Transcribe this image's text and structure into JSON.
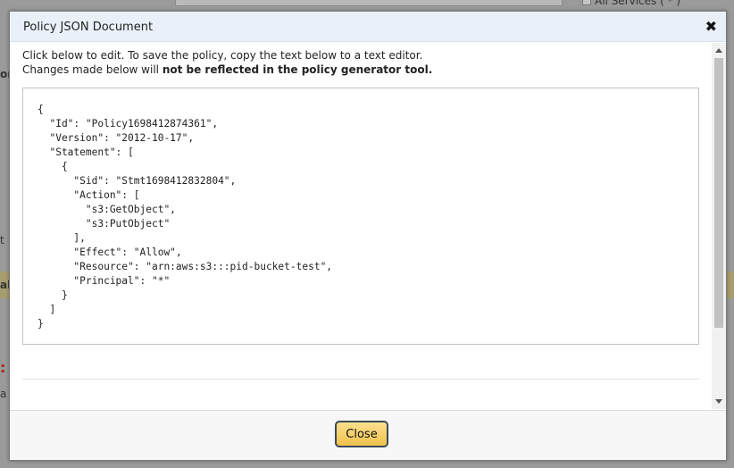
{
  "background": {
    "services_text": "All Services ( * )",
    "fragments": [
      "or",
      "t",
      "al",
      ":",
      "a"
    ]
  },
  "dialog": {
    "title": "Policy JSON Document",
    "close_icon": "close-icon",
    "instructions_line1": "Click below to edit. To save the policy, copy the text below to a text editor.",
    "instructions_line2_prefix": "Changes made below will ",
    "instructions_line2_bold": "not be reflected in the policy generator tool.",
    "policy_lines": [
      "{",
      "  \"Id\": \"Policy1698412874361\",",
      "  \"Version\": \"2012-10-17\",",
      "  \"Statement\": [",
      "    {",
      "      \"Sid\": \"Stmt1698412832804\",",
      "      \"Action\": [",
      "        \"s3:GetObject\",",
      "        \"s3:PutObject\"",
      "      ],",
      "      \"Effect\": \"Allow\",",
      "      \"Resource\": \"arn:aws:s3:::pid-bucket-test\",",
      "      \"Principal\": \"*\"",
      "    }",
      "  ]",
      "}"
    ],
    "close_button_label": "Close"
  }
}
